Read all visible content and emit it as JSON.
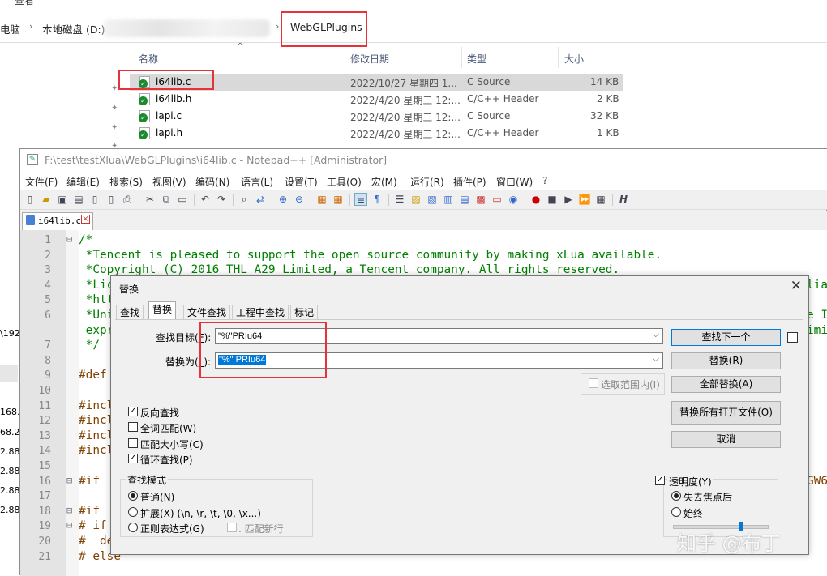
{
  "explorer": {
    "menu_partial": "查看",
    "breadcrumb": [
      "电脑",
      "本地磁盘 (D:)",
      "WebGLPlugins"
    ],
    "columns": [
      "名称",
      "修改日期",
      "类型",
      "大小"
    ],
    "files": [
      {
        "name": "i64lib.c",
        "date": "2022/10/27 星期四 1...",
        "type": "C Source",
        "size": "14 KB",
        "selected": true
      },
      {
        "name": "i64lib.h",
        "date": "2022/4/20 星期三 12:...",
        "type": "C/C++ Header",
        "size": "2 KB"
      },
      {
        "name": "lapi.c",
        "date": "2022/4/20 星期三 12:...",
        "type": "C Source",
        "size": "32 KB"
      },
      {
        "name": "lapi.h",
        "date": "2022/4/20 星期三 12:...",
        "type": "C/C++ Header",
        "size": "1 KB"
      }
    ],
    "left_partial": [
      "\\192",
      "168.",
      "68.2",
      "2.88",
      "2.88",
      "2.88",
      "2.88)"
    ]
  },
  "notepad": {
    "title": "F:\\test\\testXlua\\WebGLPlugins\\i64lib.c - Notepad++ [Administrator]",
    "menu": [
      "文件(F)",
      "编辑(E)",
      "搜索(S)",
      "视图(V)",
      "编码(N)",
      "语言(L)",
      "设置(T)",
      "工具(O)",
      "宏(M)",
      "运行(R)",
      "插件(P)",
      "窗口(W)",
      "?"
    ],
    "tab_label": "i64lib.c",
    "lines": [
      {
        "n": "1",
        "t": "/*",
        "c": "g",
        "fold": "⊟"
      },
      {
        "n": "2",
        "t": " *Tencent is pleased to support the open source community by making xLua available.",
        "c": "g"
      },
      {
        "n": "3",
        "t": " *Copyright (C) 2016 THL A29 Limited, a Tencent company. All rights reserved.",
        "c": "g"
      },
      {
        "n": "4",
        "t": " *Lic",
        "c": "g",
        "tail": "lia"
      },
      {
        "n": "5",
        "t": " *htt",
        "c": "g"
      },
      {
        "n": "6",
        "t": " *Uni",
        "c": "g",
        "tail": "e I"
      },
      {
        "n": "",
        "t": " expr",
        "c": "g",
        "tail": "imi"
      },
      {
        "n": "7",
        "t": " */",
        "c": "g"
      },
      {
        "n": "8",
        "t": "",
        "c": "g"
      },
      {
        "n": "9",
        "t": "#def",
        "c": "k"
      },
      {
        "n": "10",
        "t": "",
        "c": "g"
      },
      {
        "n": "11",
        "t": "#incl",
        "c": "k"
      },
      {
        "n": "12",
        "t": "#incl",
        "c": "k"
      },
      {
        "n": "13",
        "t": "#incl",
        "c": "k"
      },
      {
        "n": "14",
        "t": "#incl",
        "c": "k"
      },
      {
        "n": "15",
        "t": "",
        "c": "g"
      },
      {
        "n": "16",
        "t": "#if ",
        "c": "k",
        "fold": "⊟",
        "tail": "GW6"
      },
      {
        "n": "17",
        "t": "",
        "c": "g"
      },
      {
        "n": "18",
        "t": "#if ",
        "c": "k",
        "fold": "⊟"
      },
      {
        "n": "19",
        "t": "# if",
        "c": "k",
        "fold": "⊟"
      },
      {
        "n": "20",
        "t": "#  de",
        "c": "k"
      },
      {
        "n": "21",
        "t": "# else",
        "c": "k"
      }
    ]
  },
  "dialog": {
    "title": "替换",
    "tabs": [
      "查找",
      "替换",
      "文件查找",
      "工程中查找",
      "标记"
    ],
    "find_label": "查找目标(",
    "find_label_tail": "):",
    "find_value": "\"%\"PRIu64",
    "replace_label": "替换为(",
    "replace_label_tail": "):",
    "replace_value": "\"%\" PRIu64",
    "buttons": {
      "find_next": "查找下一个",
      "replace": "替换(R)",
      "replace_all": "全部替换(A)",
      "replace_all_open": "替换所有打开文件(O)",
      "cancel": "取消"
    },
    "in_selection": "选取范围内(I)",
    "options": [
      {
        "label": "反向查找",
        "checked": true
      },
      {
        "label": "全词匹配(W)",
        "checked": false
      },
      {
        "label": "匹配大小写(C)",
        "checked": false
      },
      {
        "label": "循环查找(P)",
        "checked": true
      }
    ],
    "search_mode": {
      "title": "查找模式",
      "normal": "普通(N)",
      "extended": "扩展(X) (\\n, \\r, \\t, \\0, \\x...)",
      "regex": "正则表达式(G)",
      "dot_newline": ". 匹配新行"
    },
    "transparency": {
      "title": "透明度(Y)",
      "on_lose_focus": "失去焦点后",
      "always": "始终",
      "checked": true,
      "slider_fraction": 0.72
    }
  },
  "watermark": "知乎 @布丁",
  "colors": {
    "highlight": "#e8323a",
    "comment": "#008000",
    "selection": "#0078d7"
  }
}
